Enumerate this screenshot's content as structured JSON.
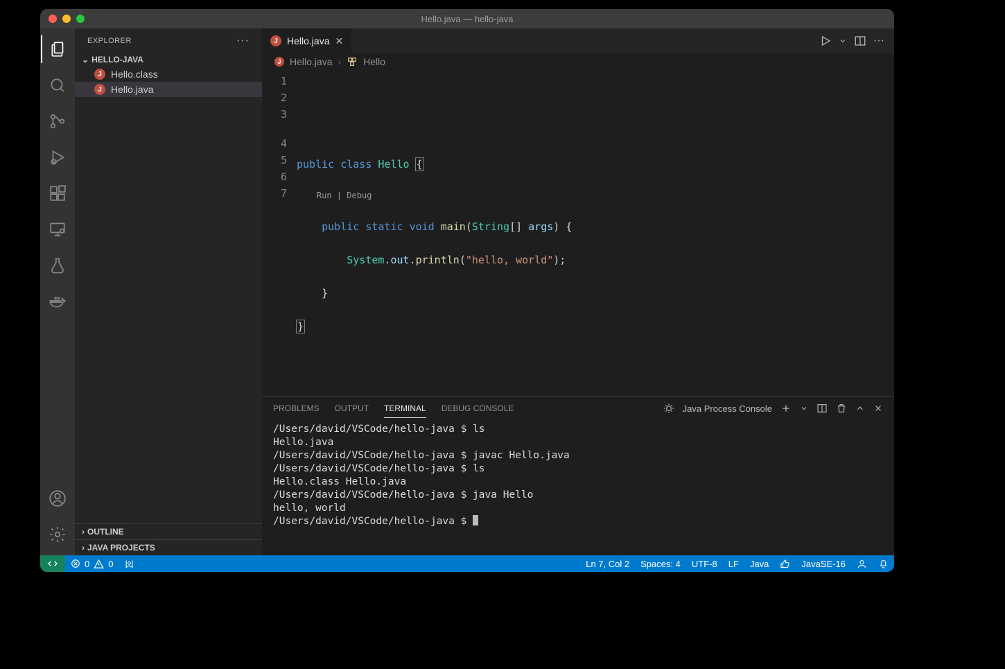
{
  "titlebar": {
    "text": "Hello.java — hello-java"
  },
  "sidebar": {
    "title": "EXPLORER",
    "folder": "HELLO-JAVA",
    "files": [
      {
        "name": "Hello.class"
      },
      {
        "name": "Hello.java"
      }
    ],
    "outline": "OUTLINE",
    "javaProjects": "JAVA PROJECTS"
  },
  "tab": {
    "name": "Hello.java"
  },
  "breadcrumb": {
    "file": "Hello.java",
    "symbol": "Hello"
  },
  "code": {
    "lines": [
      "1",
      "2",
      "3",
      "4",
      "5",
      "6",
      "7"
    ],
    "codelens": "Run | Debug",
    "kw_public1": "public",
    "kw_class": "class",
    "cls_hello": "Hello",
    "kw_public2": "public",
    "kw_static": "static",
    "kw_void": "void",
    "fn_main": "main",
    "type_string": "String",
    "var_args": "args",
    "obj_system": "System",
    "field_out": "out",
    "fn_println": "println",
    "str_hello": "\"hello, world\""
  },
  "panel": {
    "tabs": {
      "problems": "PROBLEMS",
      "output": "OUTPUT",
      "terminal": "TERMINAL",
      "debug": "DEBUG CONSOLE"
    },
    "processLabel": "Java Process Console",
    "terminal": [
      "/Users/david/VSCode/hello-java $ ls",
      "Hello.java",
      "/Users/david/VSCode/hello-java $ javac Hello.java",
      "/Users/david/VSCode/hello-java $ ls",
      "Hello.class Hello.java",
      "/Users/david/VSCode/hello-java $ java Hello",
      "hello, world",
      "/Users/david/VSCode/hello-java $ "
    ]
  },
  "status": {
    "errors": "0",
    "warnings": "0",
    "cursor": "Ln 7, Col 2",
    "spaces": "Spaces: 4",
    "encoding": "UTF-8",
    "eol": "LF",
    "lang": "Java",
    "jdk": "JavaSE-16"
  }
}
